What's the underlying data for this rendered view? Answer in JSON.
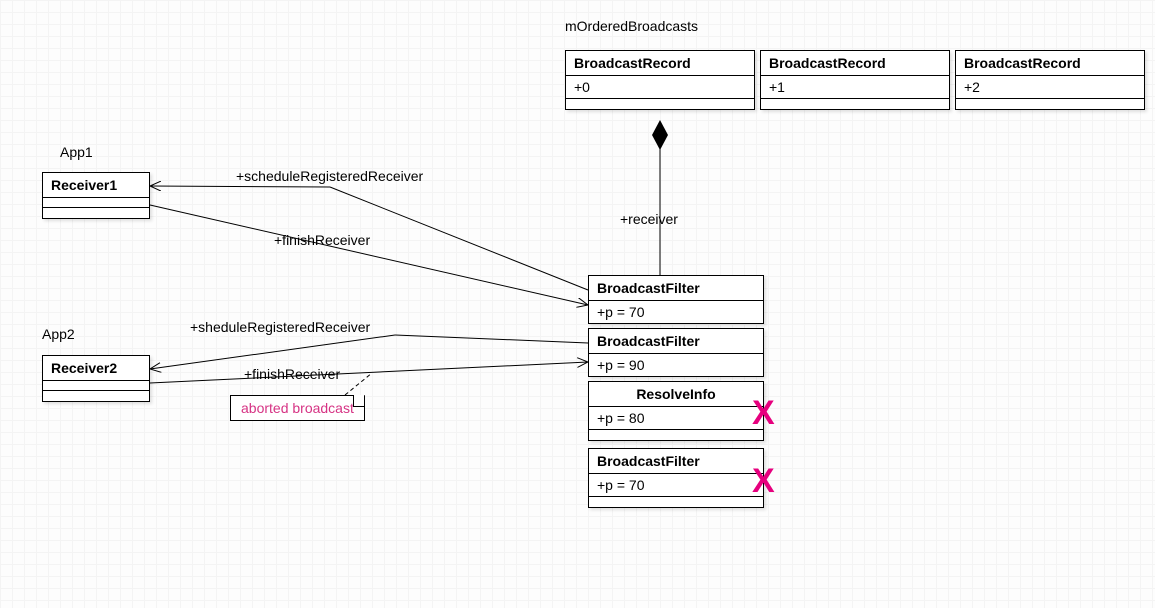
{
  "header": {
    "mOrderedBroadcasts": "mOrderedBroadcasts"
  },
  "records": [
    {
      "title": "BroadcastRecord",
      "attr": "+0"
    },
    {
      "title": "BroadcastRecord",
      "attr": "+1"
    },
    {
      "title": "BroadcastRecord",
      "attr": "+2"
    }
  ],
  "apps": {
    "app1_label": "App1",
    "receiver1_title": "Receiver1",
    "app2_label": "App2",
    "receiver2_title": "Receiver2"
  },
  "filters": [
    {
      "title": "BroadcastFilter",
      "attr": "+p = 70"
    },
    {
      "title": "BroadcastFilter",
      "attr": "+p = 90"
    },
    {
      "title": "ResolveInfo",
      "attr": "+p = 80"
    },
    {
      "title": "BroadcastFilter",
      "attr": "+p = 70"
    }
  ],
  "edges": {
    "scheduleRegisteredReceiver1": "+scheduleRegisteredReceiver",
    "finishReceiver1": "+finishReceiver",
    "sheduleRegisteredReceiver2": "+sheduleRegisteredReceiver",
    "finishReceiver2": "+finishReceiver",
    "receiver": "+receiver"
  },
  "note": {
    "aborted": "aborted broadcast"
  },
  "x1": "X",
  "x2": "X"
}
